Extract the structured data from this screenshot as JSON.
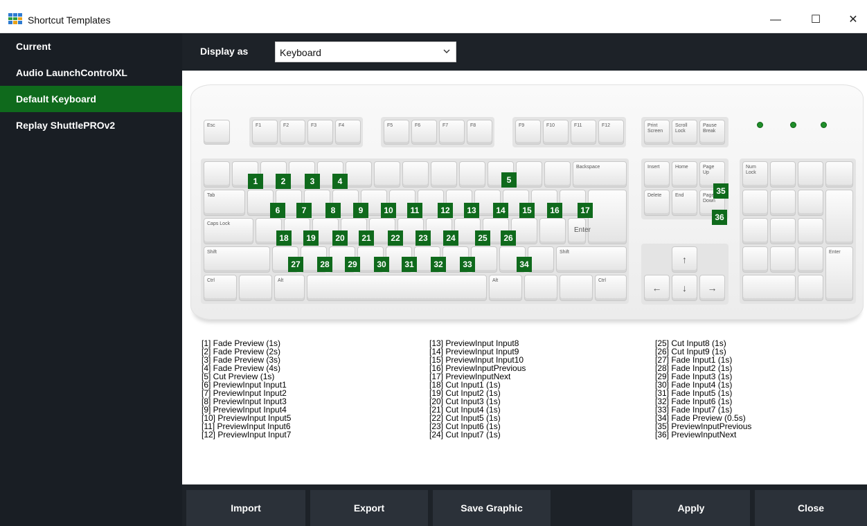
{
  "window": {
    "title": "Shortcut Templates",
    "minimize": "—",
    "maximize": "☐",
    "close": "✕"
  },
  "sidebar": {
    "items": [
      {
        "label": "Current"
      },
      {
        "label": "Audio LaunchControlXL"
      },
      {
        "label": "Default Keyboard"
      },
      {
        "label": "Replay ShuttlePROv2"
      }
    ]
  },
  "toolbar": {
    "display_label": "Display as",
    "display_value": "Keyboard"
  },
  "keyboard": {
    "keys": {
      "esc": "Esc",
      "f1": "F1",
      "f2": "F2",
      "f3": "F3",
      "f4": "F4",
      "f5": "F5",
      "f6": "F6",
      "f7": "F7",
      "f8": "F8",
      "f9": "F9",
      "f10": "F10",
      "f11": "F11",
      "f12": "F12",
      "prtsc": "Print Screen",
      "scroll": "Scroll Lock",
      "pause": "Pause Break",
      "backspace": "Backspace",
      "tab": "Tab",
      "caps": "Caps Lock",
      "enter": "Enter",
      "shift": "Shift",
      "ctrl": "Ctrl",
      "alt": "Alt",
      "insert": "Insert",
      "home": "Home",
      "pgup": "Page Up",
      "delete": "Delete",
      "end": "End",
      "pgdn": "Page Down",
      "numlock": "Num Lock",
      "numenter": "Enter"
    },
    "badges": [
      "1",
      "2",
      "3",
      "4",
      "5",
      "6",
      "7",
      "8",
      "9",
      "10",
      "11",
      "12",
      "13",
      "14",
      "15",
      "16",
      "17",
      "18",
      "19",
      "20",
      "21",
      "22",
      "23",
      "24",
      "25",
      "26",
      "27",
      "28",
      "29",
      "30",
      "31",
      "32",
      "33",
      "34",
      "35",
      "36"
    ]
  },
  "legend": {
    "col1": [
      "[1] Fade Preview (1s)",
      "[2] Fade Preview (2s)",
      "[3] Fade Preview (3s)",
      "[4] Fade Preview (4s)",
      "[5] Cut Preview (1s)",
      "[6] PreviewInput Input1",
      "[7] PreviewInput Input2",
      "[8] PreviewInput Input3",
      "[9] PreviewInput Input4",
      "[10] PreviewInput Input5",
      "[11] PreviewInput Input6",
      "[12] PreviewInput Input7"
    ],
    "col2": [
      "[13] PreviewInput Input8",
      "[14] PreviewInput Input9",
      "[15] PreviewInput Input10",
      "[16] PreviewInputPrevious",
      "[17] PreviewInputNext",
      "[18] Cut Input1 (1s)",
      "[19] Cut Input2 (1s)",
      "[20] Cut Input3 (1s)",
      "[21] Cut Input4 (1s)",
      "[22] Cut Input5 (1s)",
      "[23] Cut Input6 (1s)",
      "[24] Cut Input7 (1s)"
    ],
    "col3": [
      "[25] Cut Input8 (1s)",
      "[26] Cut Input9 (1s)",
      "[27] Fade Input1 (1s)",
      "[28] Fade Input2 (1s)",
      "[29] Fade Input3 (1s)",
      "[30] Fade Input4 (1s)",
      "[31] Fade Input5 (1s)",
      "[32] Fade Input6 (1s)",
      "[33] Fade Input7 (1s)",
      "[34] Fade Preview (0.5s)",
      "[35] PreviewInputPrevious",
      "[36] PreviewInputNext"
    ]
  },
  "footer": {
    "import": "Import",
    "export": "Export",
    "save_graphic": "Save Graphic",
    "apply": "Apply",
    "close": "Close"
  }
}
